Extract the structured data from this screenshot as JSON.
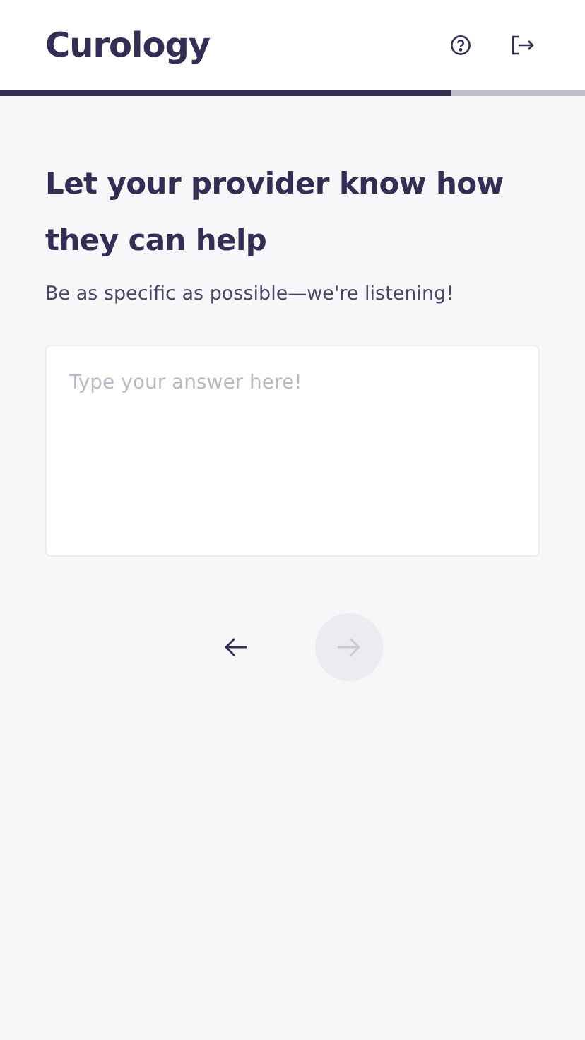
{
  "header": {
    "logo": "Curology"
  },
  "progress": {
    "level": 0.77
  },
  "question": {
    "title": "Let your provider know how they can help",
    "subtitle": "Be as specific as possible—we're listening!"
  },
  "answer": {
    "placeholder": "Type your answer here!"
  },
  "navigation": {
    "back": {
      "disabled": false
    },
    "next": {
      "disabled": true
    }
  }
}
